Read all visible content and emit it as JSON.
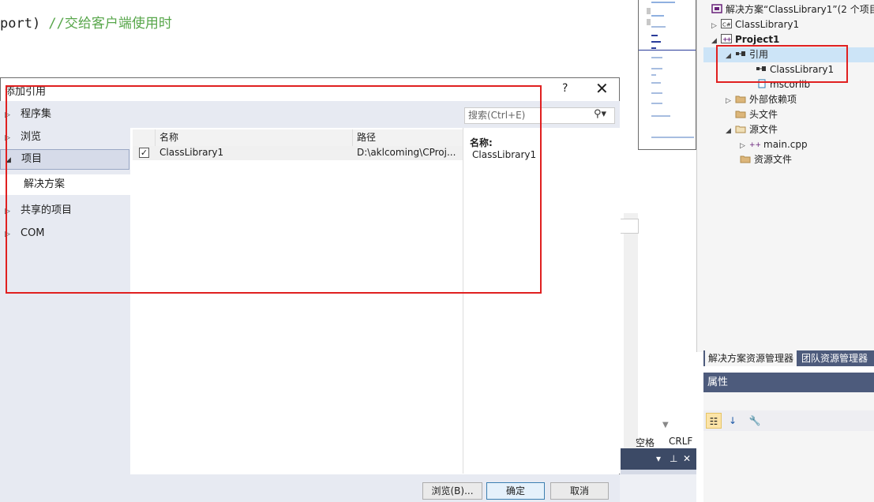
{
  "editor": {
    "code_text": "port) ",
    "code_comment": "//交给客户端使用时"
  },
  "status": {
    "spaces": "空格",
    "line_ending": "CRLF"
  },
  "solution_explorer": {
    "items": [
      {
        "label": "解决方案“ClassLibrary1”(2 个项目",
        "icon": "solution-icon",
        "arrow": ""
      },
      {
        "label": "ClassLibrary1",
        "icon": "csharp-project-icon",
        "arrow": "▷"
      },
      {
        "label": "Project1",
        "icon": "cpp-project-icon",
        "arrow": "◢"
      },
      {
        "label": "引用",
        "icon": "references-icon",
        "arrow": "◢"
      },
      {
        "label": "ClassLibrary1",
        "icon": "reference-icon",
        "arrow": ""
      },
      {
        "label": "mscorlib",
        "icon": "reference-icon",
        "arrow": ""
      },
      {
        "label": "外部依赖项",
        "icon": "folder-icon",
        "arrow": "▷"
      },
      {
        "label": "头文件",
        "icon": "folder-icon",
        "arrow": ""
      },
      {
        "label": "源文件",
        "icon": "folder-icon",
        "arrow": "◢"
      },
      {
        "label": "main.cpp",
        "icon": "cpp-file-icon",
        "arrow": "▷"
      },
      {
        "label": "资源文件",
        "icon": "folder-icon",
        "arrow": ""
      }
    ],
    "tabs": [
      "解决方案资源管理器",
      "团队资源管理器"
    ]
  },
  "properties": {
    "title": "属性"
  },
  "dialog": {
    "title": "添加引用",
    "help": "?",
    "close": "✕",
    "nav": [
      {
        "label": "程序集",
        "arrow": "▷"
      },
      {
        "label": "浏览",
        "arrow": "▷"
      },
      {
        "label": "项目",
        "arrow": "◢"
      },
      {
        "label": "解决方案",
        "arrow": ""
      },
      {
        "label": "共享的项目",
        "arrow": "▷"
      },
      {
        "label": "COM",
        "arrow": "▷"
      }
    ],
    "search_placeholder": "搜索(Ctrl+E)",
    "columns": [
      "名称",
      "路径"
    ],
    "rows": [
      {
        "checked": true,
        "name": "ClassLibrary1",
        "path": "D:\\aklcoming\\CProj..."
      }
    ],
    "detail_label": "名称:",
    "detail_value": "ClassLibrary1",
    "buttons": {
      "browse": "浏览(B)...",
      "ok": "确定",
      "cancel": "取消"
    }
  },
  "colors": {
    "highlight_border": "#e02020",
    "comment": "#57a64a",
    "panel_header": "#4d5b7c",
    "selection": "#cce4f7"
  }
}
